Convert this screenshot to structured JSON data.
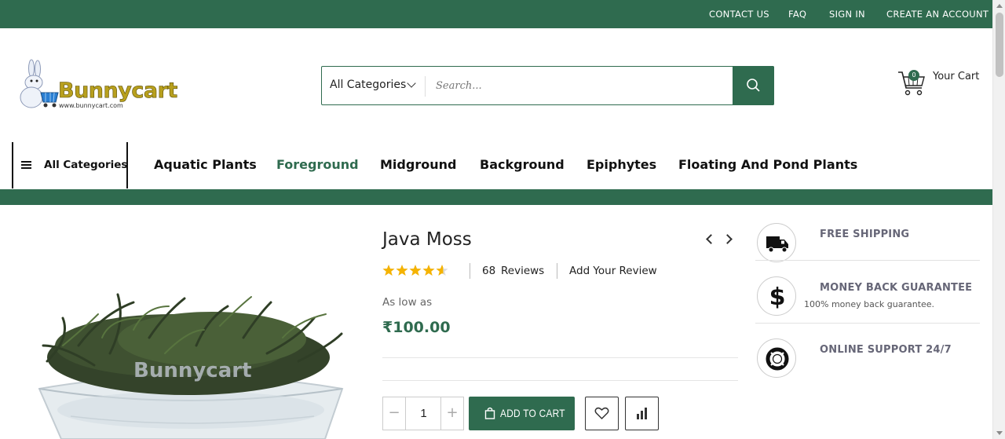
{
  "topbar": {
    "links": [
      "CONTACT US",
      "FAQ",
      "SIGN IN",
      "CREATE AN ACCOUNT"
    ]
  },
  "logo": {
    "text": "Bunnycart",
    "subtext": "www.bunnycart.com"
  },
  "search": {
    "category_label": "All Categories",
    "placeholder": "Search...",
    "value": ""
  },
  "cart": {
    "count": "0",
    "label": "Your Cart"
  },
  "nav": {
    "all_categories": "All Categories",
    "items": [
      "Aquatic Plants",
      "Foreground",
      "Midground",
      "Background",
      "Epiphytes",
      "Floating And Pond Plants"
    ],
    "active": "Foreground"
  },
  "product": {
    "title": "Java Moss",
    "rating_fraction": 0.9,
    "reviews_count": "68",
    "reviews_label": "Reviews",
    "add_review": "Add Your Review",
    "as_low_as": "As low as",
    "price": "₹100.00",
    "quantity": "1",
    "qty_minus": "−",
    "qty_plus": "+",
    "add_to_cart": "ADD TO CART"
  },
  "features": [
    {
      "title": "FREE SHIPPING",
      "desc": "",
      "icon": "truck-icon"
    },
    {
      "title": "MONEY BACK GUARANTEE",
      "desc": "100% money back guarantee.",
      "icon": "dollar-icon"
    },
    {
      "title": "ONLINE SUPPORT 24/7",
      "desc": "",
      "icon": "lifebuoy-icon"
    }
  ],
  "colors": {
    "brand_green": "#2f6b4f",
    "star": "#f5b301",
    "logo_gold": "#b8a01e"
  }
}
